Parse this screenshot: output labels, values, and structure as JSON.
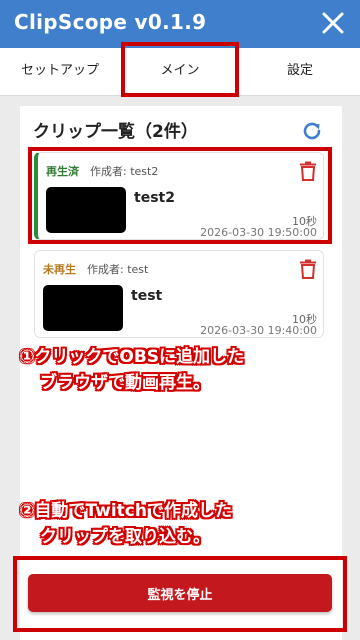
{
  "app": {
    "title": "ClipScope v0.1.9"
  },
  "tabs": [
    {
      "label": "セットアップ"
    },
    {
      "label": "メイン"
    },
    {
      "label": "設定"
    }
  ],
  "main": {
    "section_title": "クリップ一覧（2件）",
    "clips": [
      {
        "status": "再生済",
        "author": "作成者: test2",
        "title": "test2",
        "duration": "10秒",
        "datetime": "2026-03-30 19:50:00"
      },
      {
        "status": "未再生",
        "author": "作成者: test",
        "title": "test",
        "duration": "10秒",
        "datetime": "2026-03-30 19:40:00"
      }
    ],
    "stop_button": "監視を停止"
  },
  "annotations": {
    "note1_line1": "①クリックでOBSに追加した",
    "note1_line2": "ブラウザで動画再生。",
    "note2_line1": "②自動でTwitchで作成した",
    "note2_line2": "クリップを取り込む。"
  },
  "colors": {
    "titlebar": "#3f7fcb",
    "played": "#2e7d32",
    "unplayed": "#b7791f",
    "danger": "#c4181f",
    "annotation": "#cc0000"
  }
}
